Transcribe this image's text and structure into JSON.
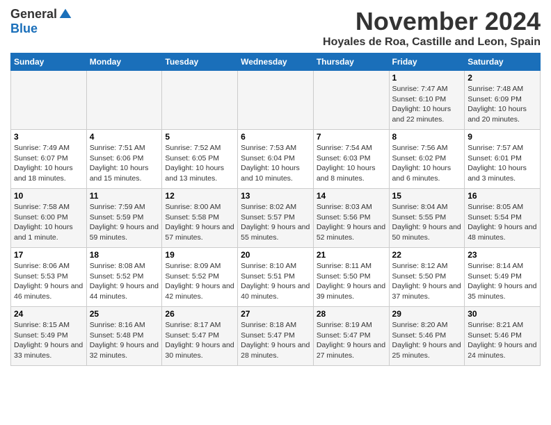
{
  "logo": {
    "general": "General",
    "blue": "Blue"
  },
  "title": {
    "month": "November 2024",
    "location": "Hoyales de Roa, Castille and Leon, Spain"
  },
  "headers": [
    "Sunday",
    "Monday",
    "Tuesday",
    "Wednesday",
    "Thursday",
    "Friday",
    "Saturday"
  ],
  "weeks": [
    [
      {
        "day": "",
        "info": ""
      },
      {
        "day": "",
        "info": ""
      },
      {
        "day": "",
        "info": ""
      },
      {
        "day": "",
        "info": ""
      },
      {
        "day": "",
        "info": ""
      },
      {
        "day": "1",
        "info": "Sunrise: 7:47 AM\nSunset: 6:10 PM\nDaylight: 10 hours and 22 minutes."
      },
      {
        "day": "2",
        "info": "Sunrise: 7:48 AM\nSunset: 6:09 PM\nDaylight: 10 hours and 20 minutes."
      }
    ],
    [
      {
        "day": "3",
        "info": "Sunrise: 7:49 AM\nSunset: 6:07 PM\nDaylight: 10 hours and 18 minutes."
      },
      {
        "day": "4",
        "info": "Sunrise: 7:51 AM\nSunset: 6:06 PM\nDaylight: 10 hours and 15 minutes."
      },
      {
        "day": "5",
        "info": "Sunrise: 7:52 AM\nSunset: 6:05 PM\nDaylight: 10 hours and 13 minutes."
      },
      {
        "day": "6",
        "info": "Sunrise: 7:53 AM\nSunset: 6:04 PM\nDaylight: 10 hours and 10 minutes."
      },
      {
        "day": "7",
        "info": "Sunrise: 7:54 AM\nSunset: 6:03 PM\nDaylight: 10 hours and 8 minutes."
      },
      {
        "day": "8",
        "info": "Sunrise: 7:56 AM\nSunset: 6:02 PM\nDaylight: 10 hours and 6 minutes."
      },
      {
        "day": "9",
        "info": "Sunrise: 7:57 AM\nSunset: 6:01 PM\nDaylight: 10 hours and 3 minutes."
      }
    ],
    [
      {
        "day": "10",
        "info": "Sunrise: 7:58 AM\nSunset: 6:00 PM\nDaylight: 10 hours and 1 minute."
      },
      {
        "day": "11",
        "info": "Sunrise: 7:59 AM\nSunset: 5:59 PM\nDaylight: 9 hours and 59 minutes."
      },
      {
        "day": "12",
        "info": "Sunrise: 8:00 AM\nSunset: 5:58 PM\nDaylight: 9 hours and 57 minutes."
      },
      {
        "day": "13",
        "info": "Sunrise: 8:02 AM\nSunset: 5:57 PM\nDaylight: 9 hours and 55 minutes."
      },
      {
        "day": "14",
        "info": "Sunrise: 8:03 AM\nSunset: 5:56 PM\nDaylight: 9 hours and 52 minutes."
      },
      {
        "day": "15",
        "info": "Sunrise: 8:04 AM\nSunset: 5:55 PM\nDaylight: 9 hours and 50 minutes."
      },
      {
        "day": "16",
        "info": "Sunrise: 8:05 AM\nSunset: 5:54 PM\nDaylight: 9 hours and 48 minutes."
      }
    ],
    [
      {
        "day": "17",
        "info": "Sunrise: 8:06 AM\nSunset: 5:53 PM\nDaylight: 9 hours and 46 minutes."
      },
      {
        "day": "18",
        "info": "Sunrise: 8:08 AM\nSunset: 5:52 PM\nDaylight: 9 hours and 44 minutes."
      },
      {
        "day": "19",
        "info": "Sunrise: 8:09 AM\nSunset: 5:52 PM\nDaylight: 9 hours and 42 minutes."
      },
      {
        "day": "20",
        "info": "Sunrise: 8:10 AM\nSunset: 5:51 PM\nDaylight: 9 hours and 40 minutes."
      },
      {
        "day": "21",
        "info": "Sunrise: 8:11 AM\nSunset: 5:50 PM\nDaylight: 9 hours and 39 minutes."
      },
      {
        "day": "22",
        "info": "Sunrise: 8:12 AM\nSunset: 5:50 PM\nDaylight: 9 hours and 37 minutes."
      },
      {
        "day": "23",
        "info": "Sunrise: 8:14 AM\nSunset: 5:49 PM\nDaylight: 9 hours and 35 minutes."
      }
    ],
    [
      {
        "day": "24",
        "info": "Sunrise: 8:15 AM\nSunset: 5:49 PM\nDaylight: 9 hours and 33 minutes."
      },
      {
        "day": "25",
        "info": "Sunrise: 8:16 AM\nSunset: 5:48 PM\nDaylight: 9 hours and 32 minutes."
      },
      {
        "day": "26",
        "info": "Sunrise: 8:17 AM\nSunset: 5:47 PM\nDaylight: 9 hours and 30 minutes."
      },
      {
        "day": "27",
        "info": "Sunrise: 8:18 AM\nSunset: 5:47 PM\nDaylight: 9 hours and 28 minutes."
      },
      {
        "day": "28",
        "info": "Sunrise: 8:19 AM\nSunset: 5:47 PM\nDaylight: 9 hours and 27 minutes."
      },
      {
        "day": "29",
        "info": "Sunrise: 8:20 AM\nSunset: 5:46 PM\nDaylight: 9 hours and 25 minutes."
      },
      {
        "day": "30",
        "info": "Sunrise: 8:21 AM\nSunset: 5:46 PM\nDaylight: 9 hours and 24 minutes."
      }
    ]
  ]
}
